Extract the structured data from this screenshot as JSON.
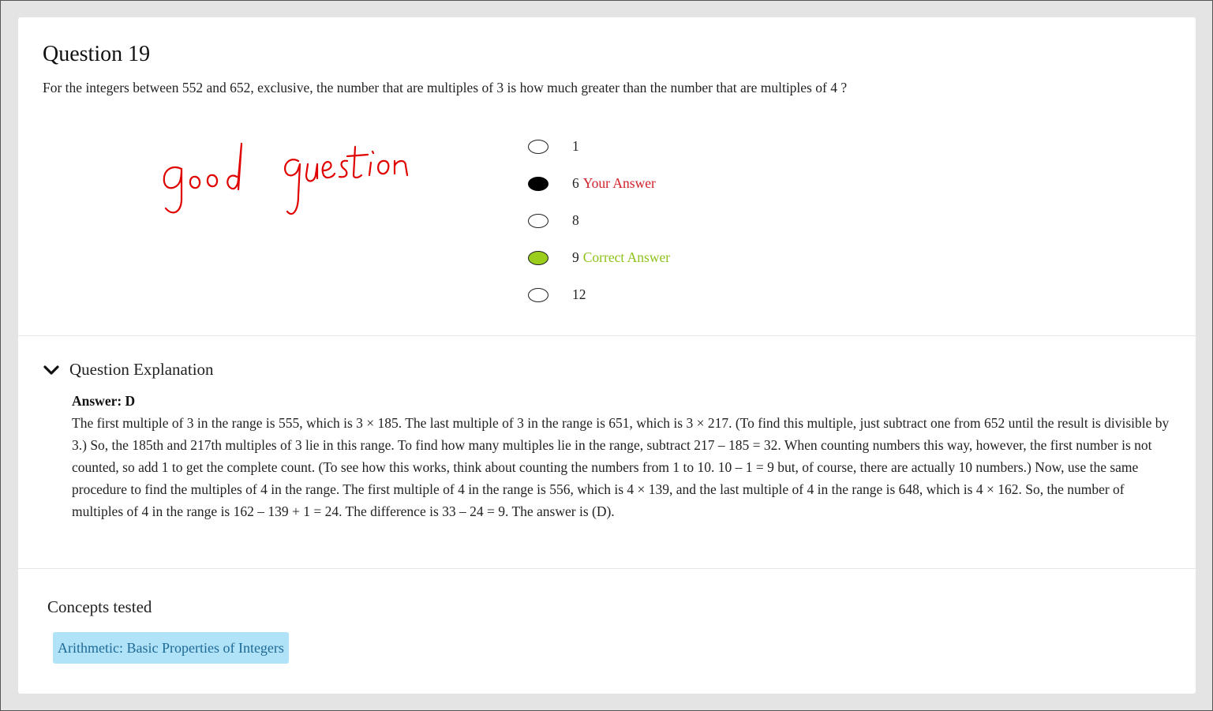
{
  "question": {
    "title": "Question 19",
    "text": "For the integers between 552 and 652, exclusive, the number that are multiples of 3 is how much greater than the number that are multiples of 4 ?"
  },
  "annotation": {
    "handwritten_text": "good question",
    "color": "#e00000"
  },
  "options": [
    {
      "label": "1",
      "state": "unselected",
      "tag": ""
    },
    {
      "label": "6",
      "state": "selected",
      "tag": "Your Answer"
    },
    {
      "label": "8",
      "state": "unselected",
      "tag": ""
    },
    {
      "label": "9",
      "state": "correct",
      "tag": "Correct Answer"
    },
    {
      "label": "12",
      "state": "unselected",
      "tag": ""
    }
  ],
  "explanation": {
    "header": "Question Explanation",
    "toggle_icon": "chevron-down-icon",
    "answer_label": "Answer: D",
    "body": "The first multiple of 3 in the range is 555, which is 3 × 185. The last multiple of 3 in the range is 651, which is 3 × 217. (To find this multiple, just subtract one from 652 until the result is divisible by 3.) So, the 185th and 217th multiples of 3 lie in this range. To find how many multiples lie in the range, subtract 217 – 185 = 32. When counting numbers this way, however, the first number is not counted, so add 1 to get the complete count. (To see how this works, think about counting the numbers from 1 to 10. 10 – 1 = 9 but, of course, there are actually 10 numbers.) Now, use the same procedure to find the multiples of 4 in the range. The first multiple of 4 in the range is 556, which is 4 × 139, and the last multiple of 4 in the range is 648, which is 4 × 162. So, the number of multiples of 4 in the range is 162 – 139 + 1 = 24. The difference is 33 – 24 = 9. The answer is (D)."
  },
  "concepts": {
    "title": "Concepts tested",
    "items": [
      "Arithmetic: Basic Properties of Integers"
    ]
  },
  "colors": {
    "your_answer": "#d0202a",
    "correct_answer": "#8dc21a",
    "correct_radio_fill": "#9acd1c",
    "concept_chip_bg": "#b0e2f8",
    "concept_chip_text": "#1e6a96"
  }
}
